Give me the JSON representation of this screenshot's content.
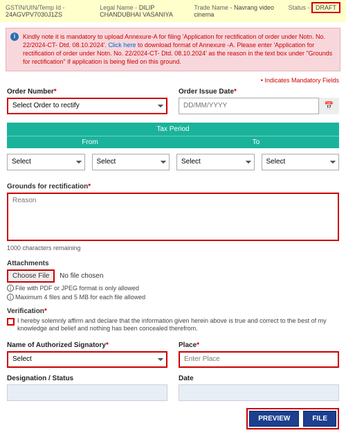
{
  "header": {
    "gstin_label": "GSTIN/UIN/Temp Id -",
    "gstin": "24AGVPV7030J1ZS",
    "legal_label": "Legal Name - ",
    "legal_name": "DILIP CHANDUBHAI VASANIYA",
    "trade_label": "Trade Name - ",
    "trade_name": "Navrang video cinema",
    "status_label": "Status -",
    "status_value": "DRAFT"
  },
  "info": {
    "pre": "Kindly note it is mandatory to upload Annexure-A for filing 'Application for rectification of order under Notn. No. 22/2024-CT- Dtd. 08.10.2024'. ",
    "link": "Click here",
    "post": " to download format of Annexure -A. Please enter 'Application for rectification of order under Notn. No. 22/2024-CT- Dtd. 08.10.2024' as the reason in the text box under \"Grounds for rectification\" if application is being filed on this ground."
  },
  "mandatory_note": "• Indicates Mandatory Fields",
  "order": {
    "number_label": "Order Number",
    "number_placeholder": "Select Order to rectify",
    "date_label": "Order Issue Date",
    "date_placeholder": "DD/MM/YYYY"
  },
  "tax_period": {
    "title": "Tax Period",
    "from": "From",
    "to": "To",
    "select": "Select"
  },
  "grounds": {
    "label": "Grounds for rectification",
    "placeholder": "Reason",
    "remaining": "1000 characters remaining"
  },
  "attachments": {
    "label": "Attachments",
    "choose": "Choose File",
    "nofile": "No file chosen",
    "note1": "File with PDF or JPEG format is only allowed",
    "note2": "Maximum 4 files and 5 MB for each file allowed"
  },
  "verification": {
    "label": "Verification",
    "text": "I hereby solemnly affirm and declare that the information given herein above is true and correct to the best of my knowledge and belief and nothing has been concealed therefrom."
  },
  "signatory": {
    "name_label": "Name of Authorized Signatory",
    "name_placeholder": "Select",
    "place_label": "Place",
    "place_placeholder": "Enter Place",
    "designation_label": "Designation / Status",
    "date_label": "Date"
  },
  "buttons": {
    "preview": "PREVIEW",
    "file": "FILE"
  }
}
